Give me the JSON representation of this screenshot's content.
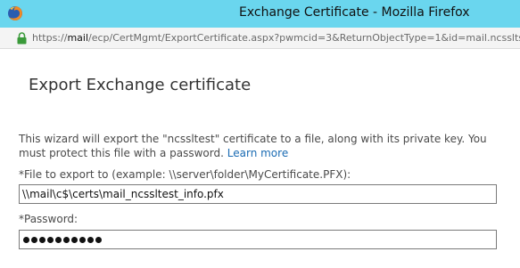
{
  "window": {
    "title": "Exchange Certificate - Mozilla Firefox"
  },
  "addressbar": {
    "url_prefix": "https://",
    "url_host": "mail",
    "url_rest": "/ecp/CertMgmt/ExportCertificate.aspx?pwmcid=3&ReturnObjectType=1&id=mail.ncsslts"
  },
  "page": {
    "title": "Export Exchange certificate",
    "description": "This wizard will export the \"ncssltest\" certificate to a file, along with its private key. You must protect this file with a password.",
    "learn_more": "Learn more",
    "file_label": "*File to export to (example: \\\\server\\folder\\MyCertificate.PFX):",
    "file_value": "\\\\mail\\c$\\certs\\mail_ncssltest_info.pfx",
    "password_label": "*Password:",
    "password_length": 10
  },
  "colors": {
    "titlebar": "#6ad6ee",
    "link": "#1a6bb3"
  },
  "icons": {
    "browser": "firefox-icon",
    "secure": "lock-icon"
  }
}
